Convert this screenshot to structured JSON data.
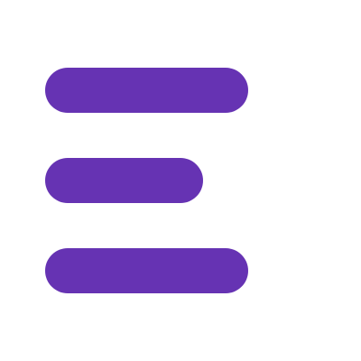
{
  "icon": {
    "name": "menu-lines-icon",
    "color": "#6633b3",
    "background": "#ffffff"
  }
}
